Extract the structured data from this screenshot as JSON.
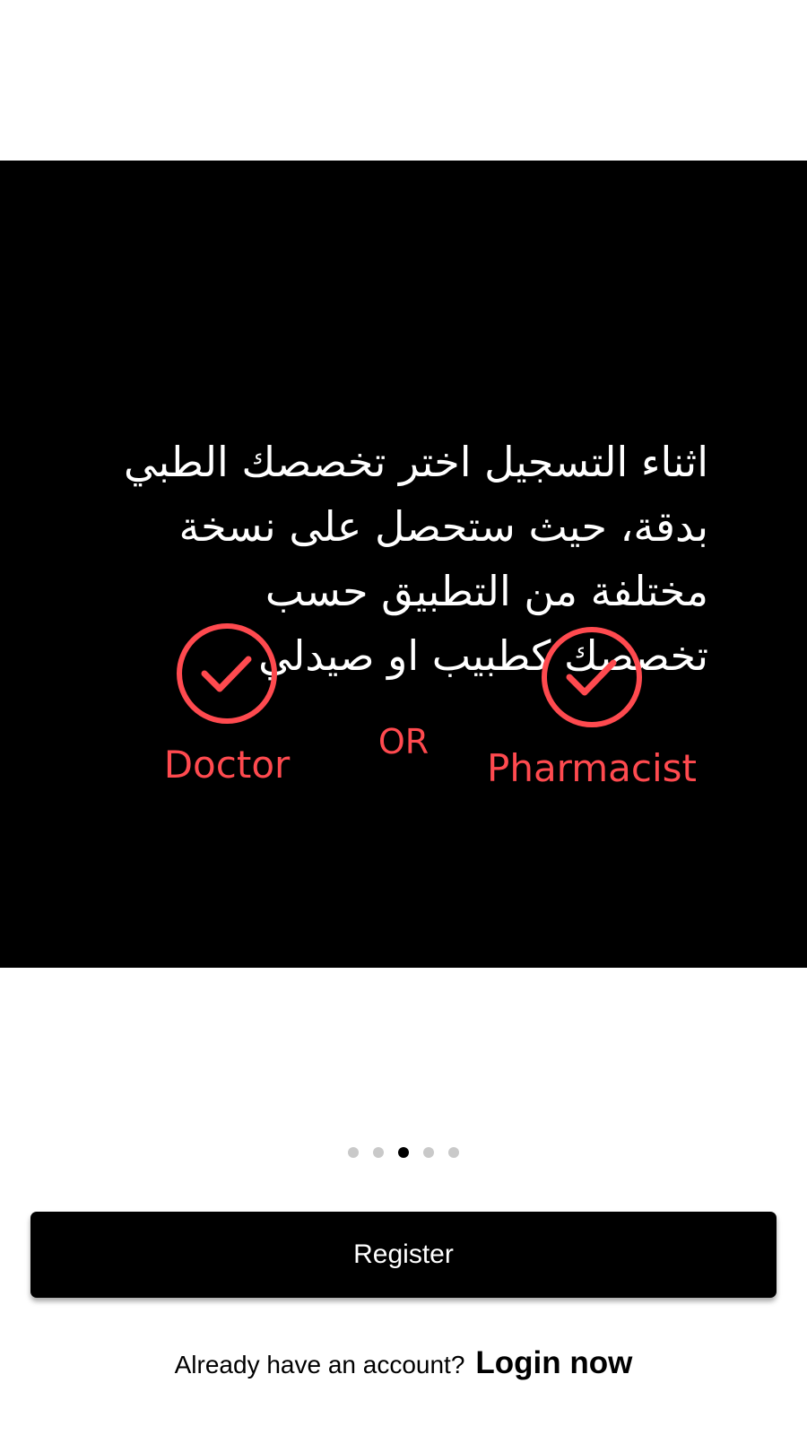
{
  "slide": {
    "text_lines": [
      "اثناء التسجيل اختر تخصصك الطبي",
      "بدقة، حيث ستحصل على نسخة",
      "مختلفة من التطبيق حسب",
      "تخصصك كطبيب او صيدلي"
    ],
    "option_doctor": "Doctor",
    "separator": "OR",
    "option_pharmacist": "Pharmacist",
    "check_icon": "check-circle-icon",
    "accent_color": "#ff4a4f"
  },
  "pagination": {
    "total": 5,
    "active_index": 3
  },
  "register_button": {
    "label": "Register"
  },
  "login": {
    "prompt": "Already have an account?",
    "link": "Login now"
  }
}
